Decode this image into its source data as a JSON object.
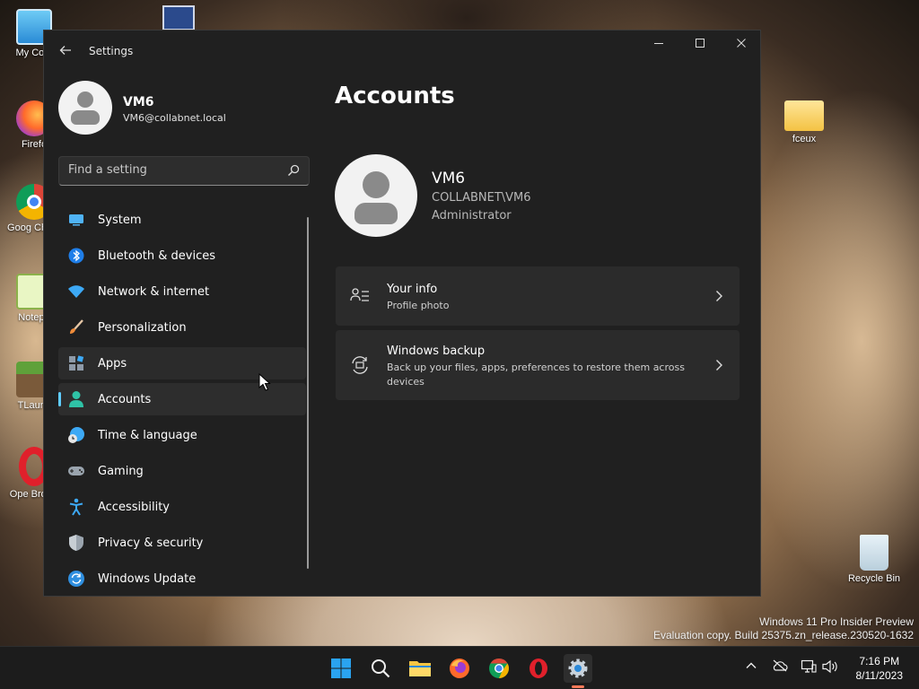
{
  "desktop": {
    "icons": [
      {
        "label": "My Com"
      },
      {
        "label": "Firefo"
      },
      {
        "label": "Goog Chron"
      },
      {
        "label": "Notepa"
      },
      {
        "label": "TLaunc"
      },
      {
        "label": "Ope Brows"
      },
      {
        "label": "fceux"
      },
      {
        "label": "Recycle Bin"
      }
    ],
    "watermark_line1": "Windows 11 Pro Insider Preview",
    "watermark_line2": "Evaluation copy. Build 25375.zn_release.230520-1632"
  },
  "window": {
    "title": "Settings",
    "profile": {
      "name": "VM6",
      "email": "VM6@collabnet.local"
    },
    "search": {
      "placeholder": "Find a setting"
    },
    "nav": [
      {
        "label": "System",
        "icon": "system-icon"
      },
      {
        "label": "Bluetooth & devices",
        "icon": "bluetooth-icon"
      },
      {
        "label": "Network & internet",
        "icon": "wifi-icon"
      },
      {
        "label": "Personalization",
        "icon": "brush-icon"
      },
      {
        "label": "Apps",
        "icon": "apps-icon"
      },
      {
        "label": "Accounts",
        "icon": "person-icon"
      },
      {
        "label": "Time & language",
        "icon": "globe-clock-icon"
      },
      {
        "label": "Gaming",
        "icon": "controller-icon"
      },
      {
        "label": "Accessibility",
        "icon": "accessibility-icon"
      },
      {
        "label": "Privacy & security",
        "icon": "shield-icon"
      },
      {
        "label": "Windows Update",
        "icon": "update-icon"
      }
    ],
    "selected_nav": "Accounts",
    "page": {
      "title": "Accounts",
      "account": {
        "name": "VM6",
        "domain": "COLLABNET\\VM6",
        "role": "Administrator"
      },
      "cards": [
        {
          "title": "Your info",
          "subtitle": "Profile photo"
        },
        {
          "title": "Windows backup",
          "subtitle": "Back up your files, apps, preferences to restore them across devices"
        }
      ]
    }
  },
  "taskbar": {
    "time": "7:16 PM",
    "date": "8/11/2023"
  },
  "colors": {
    "accent": "#60cdff",
    "window_bg": "#202020",
    "card_bg": "#2b2b2b",
    "taskbar_bg": "#1c1c1c"
  }
}
